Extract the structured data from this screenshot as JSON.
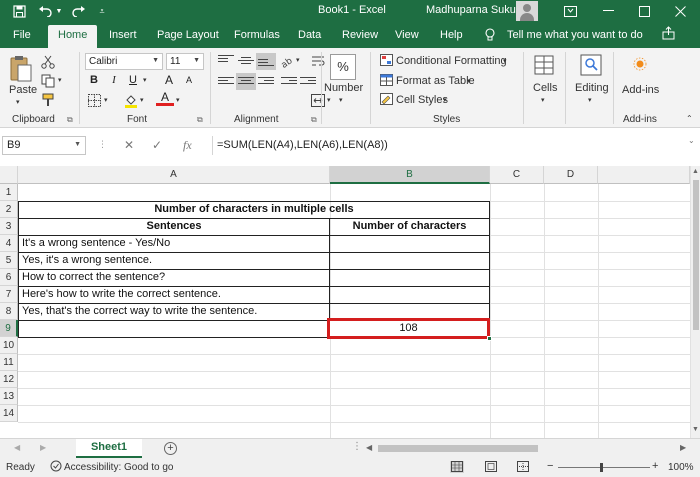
{
  "titlebar": {
    "title": "Book1  -  Excel",
    "user": "Madhuparna Sukul",
    "icons": [
      "save-icon",
      "undo-icon",
      "redo-icon",
      "customize-icon",
      "ribbon-display-icon",
      "minimize-icon",
      "maximize-icon",
      "close-icon"
    ]
  },
  "tabs": {
    "file": "File",
    "home": "Home",
    "insert": "Insert",
    "page_layout": "Page Layout",
    "formulas": "Formulas",
    "data": "Data",
    "review": "Review",
    "view": "View",
    "help": "Help",
    "tell_me": "Tell me what you want to do"
  },
  "ribbon": {
    "clipboard": {
      "paste": "Paste",
      "label": "Clipboard"
    },
    "font": {
      "name": "Calibri",
      "size": "11",
      "bold": "B",
      "italic": "I",
      "underline": "U",
      "grow": "A",
      "shrink": "A",
      "font_color": "A",
      "label": "Font"
    },
    "alignment": {
      "label": "Alignment"
    },
    "number": {
      "percent": "%",
      "label": "Number"
    },
    "styles": {
      "conditional": "Conditional Formatting",
      "format_table": "Format as Table",
      "cell_styles": "Cell Styles",
      "label": "Styles"
    },
    "cells": {
      "label": "Cells"
    },
    "editing": {
      "label": "Editing"
    },
    "addins": {
      "button": "Add-ins",
      "label": "Add-ins"
    }
  },
  "formula_bar": {
    "name_box": "B9",
    "cancel": "✕",
    "enter": "✓",
    "fx": "fx",
    "formula": "=SUM(LEN(A4),LEN(A6),LEN(A8))"
  },
  "sheet": {
    "columns": [
      "A",
      "B",
      "C",
      "D"
    ],
    "rows": [
      "1",
      "2",
      "3",
      "4",
      "5",
      "6",
      "7",
      "8",
      "9",
      "10",
      "11",
      "12",
      "13",
      "14"
    ],
    "title": "Number of characters in multiple cells",
    "headers": {
      "a": "Sentences",
      "b": "Number of characters"
    },
    "sentences": [
      "It's a wrong sentence - Yes/No",
      "Yes, it's a wrong sentence.",
      "How to correct the sentence?",
      "Here's how to write the correct sentence.",
      "Yes, that's the correct way to write the sentence."
    ],
    "result": "108"
  },
  "sheet_tabs": {
    "active": "Sheet1",
    "add": "+"
  },
  "status": {
    "ready": "Ready",
    "accessibility": "Accessibility: Good to go",
    "zoom": "100%"
  }
}
